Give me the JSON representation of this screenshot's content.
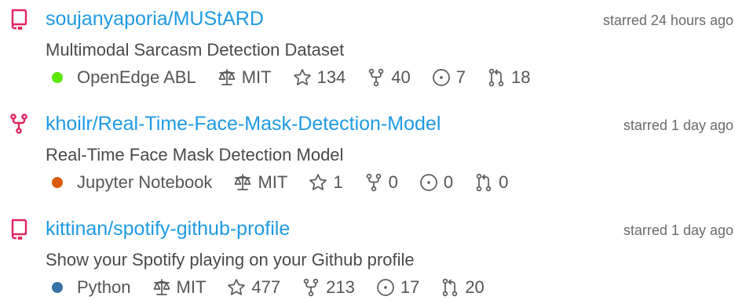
{
  "repos": [
    {
      "type": "repo",
      "icon": "book-repo-icon",
      "name": "soujanyaporia/MUStARD",
      "starred": "starred 24 hours ago",
      "description": "Multimodal Sarcasm Detection Dataset",
      "language": "OpenEdge ABL",
      "language_color": "#5ce600",
      "license": "MIT",
      "stars": "134",
      "forks": "40",
      "issues": "7",
      "prs": "18"
    },
    {
      "type": "fork",
      "icon": "fork-repo-icon",
      "name": "khoilr/Real-Time-Face-Mask-Detection-Model",
      "starred": "starred 1 day ago",
      "description": "Real-Time Face Mask Detection Model",
      "language": "Jupyter Notebook",
      "language_color": "#da5b0b",
      "license": "MIT",
      "stars": "1",
      "forks": "0",
      "issues": "0",
      "prs": "0"
    },
    {
      "type": "repo",
      "icon": "book-repo-icon",
      "name": "kittinan/spotify-github-profile",
      "starred": "starred 1 day ago",
      "description": "Show your Spotify playing on your Github profile",
      "language": "Python",
      "language_color": "#3572a5",
      "license": "MIT",
      "stars": "477",
      "forks": "213",
      "issues": "17",
      "prs": "20"
    }
  ],
  "colors": {
    "link": "#1e9ae3",
    "icon_accent": "#e0245e"
  }
}
